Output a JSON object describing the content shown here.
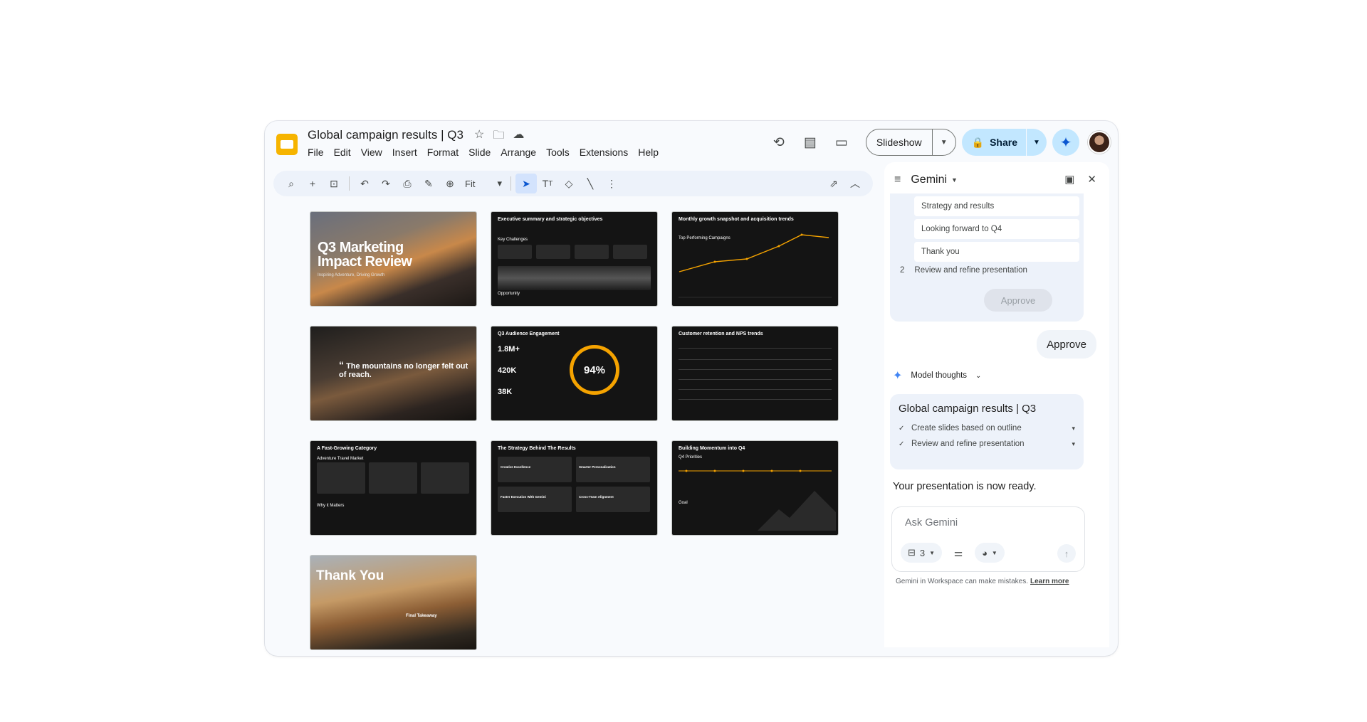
{
  "colors": {
    "accent": "#0b57d0",
    "share_bg": "#c2e7ff",
    "slides_brand": "#f6b400",
    "ring": "#f5a300"
  },
  "header": {
    "doc_title": "Global campaign results | Q3",
    "menu": [
      "File",
      "Edit",
      "View",
      "Insert",
      "Format",
      "Slide",
      "Arrange",
      "Tools",
      "Extensions",
      "Help"
    ],
    "slideshow_label": "Slideshow",
    "share_label": "Share",
    "icons": [
      "star-icon",
      "move-folder-icon",
      "cloud-status-icon",
      "history-icon",
      "comments-icon",
      "meet-icon",
      "lock-icon",
      "gemini-icon"
    ]
  },
  "toolbar": {
    "zoom": "Fit"
  },
  "slides": [
    {
      "title": "Q3 Marketing Impact Review",
      "subtitle": "Inspiring Adventure, Driving Growth"
    },
    {
      "title": "Executive summary and strategic objectives",
      "section": "Key Challenges",
      "section2": "Opportunity"
    },
    {
      "title": "Monthly growth snapshot and acquisition trends",
      "section": "Top Performing Campaigns"
    },
    {
      "quote": "The mountains no longer felt out of reach."
    },
    {
      "title": "Q3 Audience Engagement",
      "stat1": "1.8M+",
      "stat2": "420K",
      "stat3": "38K",
      "ring": "94%"
    },
    {
      "title": "Customer retention and NPS trends"
    },
    {
      "title": "A Fast-Growing Category",
      "section": "Adventure Travel Market",
      "section2": "Why it Matters"
    },
    {
      "title": "The Strategy Behind The Results",
      "cards": [
        "Creative Excellence",
        "Smarter Personalization",
        "Faster Execution With Gemini",
        "Cross-Team Alignment"
      ]
    },
    {
      "title": "Building Momentum into Q4",
      "section": "Q4 Priorities",
      "section2": "Goal"
    },
    {
      "title": "Thank You",
      "subtitle": "Final Takeaway"
    }
  ],
  "gemini": {
    "title": "Gemini",
    "plan_items": [
      "Strategy and results",
      "Looking forward to Q4",
      "Thank you"
    ],
    "plan_step_num": "2",
    "plan_step_label": "Review and refine presentation",
    "approve_disabled": "Approve",
    "user_message": "Approve",
    "model_thoughts": "Model thoughts",
    "summary_title": "Global campaign results | Q3",
    "summary_steps": [
      "Create slides based on outline",
      "Review and refine presentation"
    ],
    "ready_text": "Your presentation is now ready.",
    "ask_placeholder": "Ask Gemini",
    "source_count": "3",
    "disclaimer": "Gemini in Workspace can make mistakes.",
    "learn_more": "Learn more"
  }
}
